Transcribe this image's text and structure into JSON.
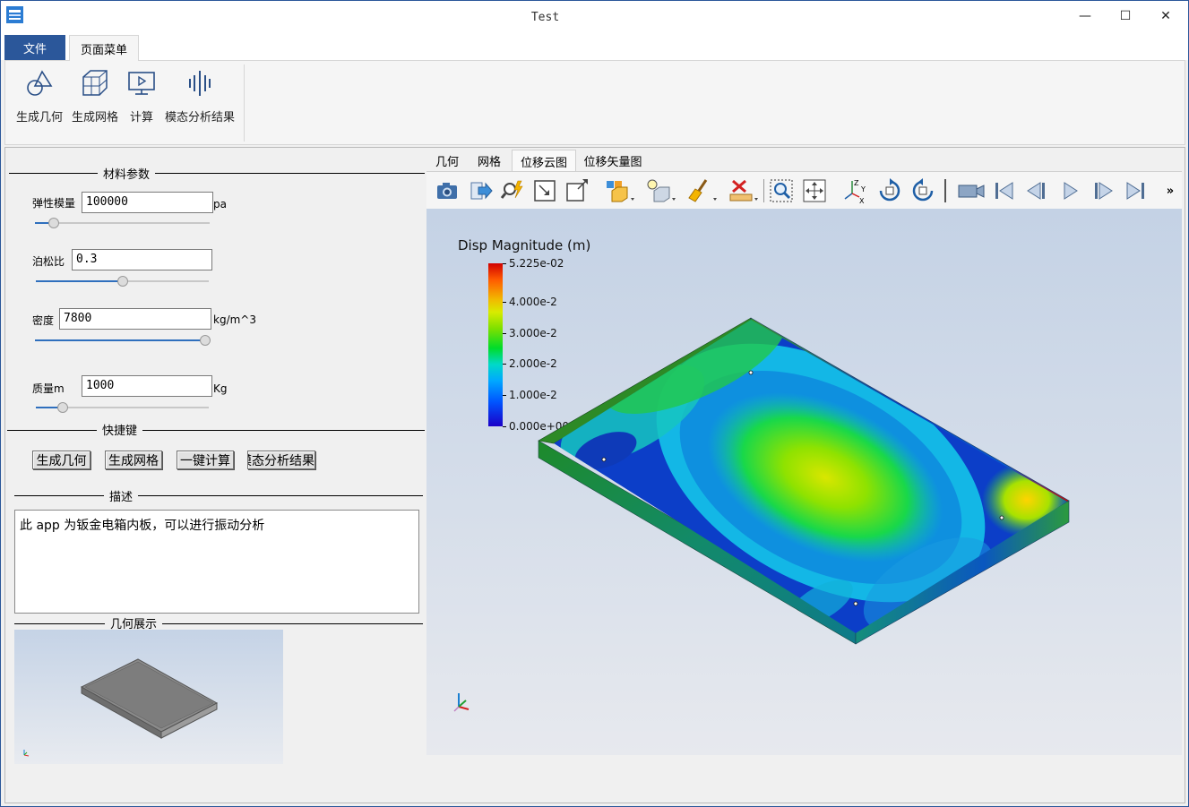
{
  "window": {
    "title": "Test"
  },
  "window_controls": {
    "minimize": "—",
    "maximize": "☐",
    "close": "✕"
  },
  "ribbon": {
    "tabs": [
      {
        "label": "文件"
      },
      {
        "label": "页面菜单"
      }
    ],
    "buttons": [
      {
        "label": "生成几何",
        "icon": "geometry-icon"
      },
      {
        "label": "生成网格",
        "icon": "mesh-icon"
      },
      {
        "label": "计算",
        "icon": "compute-icon"
      },
      {
        "label": "模态分析结果",
        "icon": "modal-result-icon"
      }
    ]
  },
  "left_panel": {
    "material_group": "材料参数",
    "params": [
      {
        "label": "弹性模量",
        "value": "100000",
        "unit": "pa",
        "slider_fraction": 0.08
      },
      {
        "label": "泊松比",
        "value": "0.3",
        "unit": "",
        "slider_fraction": 0.5
      },
      {
        "label": "密度",
        "value": "7800",
        "unit": "kg/m^3",
        "slider_fraction": 1.0
      },
      {
        "label": "质量m",
        "value": "1000",
        "unit": "Kg",
        "slider_fraction": 0.13
      }
    ],
    "shortcut_group": "快捷键",
    "shortcuts": [
      {
        "label": "生成几何"
      },
      {
        "label": "生成网格"
      },
      {
        "label": "一键计算"
      },
      {
        "label": "模态分析结果"
      }
    ],
    "description_group": "描述",
    "description": "此 app 为钣金电箱内板，可以进行振动分析",
    "geometry_group": "几何展示"
  },
  "viewer": {
    "tabs": [
      {
        "label": "几何"
      },
      {
        "label": "网格"
      },
      {
        "label": "位移云图"
      },
      {
        "label": "位移矢量图"
      }
    ],
    "active_tab": "位移云图",
    "toolbar_icons": [
      "camera-icon",
      "export-icon",
      "zoom-pick-icon",
      "fit-view-icon",
      "zoom-box-icon",
      "view-cube-icon",
      "light-icon",
      "clear-brush-icon",
      "ruler-delete-icon",
      "zoom-window-icon",
      "pan-icon",
      "axes-icon",
      "rotate-cw-icon",
      "rotate-ccw-icon",
      "record-video-icon",
      "first-frame-icon",
      "prev-frame-icon",
      "play-icon",
      "next-frame-icon",
      "last-frame-icon"
    ],
    "more_label": "»",
    "legend": {
      "title": "Disp Magnitude (m)",
      "max_label": "5.225e-02",
      "ticks": [
        {
          "value": 0.04,
          "label": "4.000e-2"
        },
        {
          "value": 0.03,
          "label": "3.000e-2"
        },
        {
          "value": 0.02,
          "label": "2.000e-2"
        },
        {
          "value": 0.01,
          "label": "1.000e-2"
        },
        {
          "value": 0.0,
          "label": "0.000e+00"
        }
      ],
      "range": [
        0.0,
        0.05225
      ]
    }
  },
  "colors": {
    "accent": "#2b579a",
    "slider": "#2f6fbd"
  }
}
